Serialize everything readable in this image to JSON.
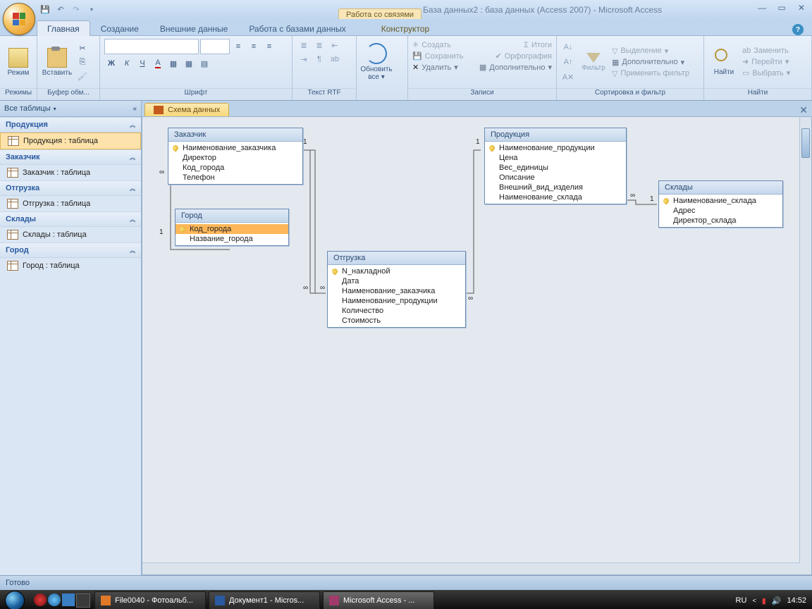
{
  "title": {
    "context": "Работа со связями",
    "main": "База данных2 : база данных (Access 2007) - Microsoft Access"
  },
  "ribbon": {
    "tabs": [
      "Главная",
      "Создание",
      "Внешние данные",
      "Работа с базами данных"
    ],
    "context_tab": "Конструктор",
    "active_index": 0,
    "groups": {
      "modes": "Режимы",
      "clipboard": "Буфер обм...",
      "font": "Шрифт",
      "rtf": "Текст RTF",
      "records": "Записи",
      "sortfilter": "Сортировка и фильтр",
      "find": "Найти"
    },
    "buttons": {
      "mode": "Режим",
      "paste": "Вставить",
      "refresh_l1": "Обновить",
      "refresh_l2": "все",
      "filter": "Фильтр",
      "find": "Найти",
      "bold": "Ж",
      "italic": "К",
      "underline": "Ч",
      "new": "Создать",
      "totals": "Итоги",
      "save": "Сохранить",
      "spelling": "Орфография",
      "delete": "Удалить",
      "more": "Дополнительно",
      "selection": "Выделение",
      "advanced": "Дополнительно",
      "toggle": "Применить фильтр",
      "replace": "Заменить",
      "goto": "Перейти",
      "select": "Выбрать"
    }
  },
  "navpane": {
    "header": "Все таблицы",
    "groups": [
      {
        "title": "Продукция",
        "items": [
          "Продукция : таблица"
        ],
        "active": true
      },
      {
        "title": "Заказчик",
        "items": [
          "Заказчик : таблица"
        ]
      },
      {
        "title": "Отгрузка",
        "items": [
          "Отгрузка : таблица"
        ]
      },
      {
        "title": "Склады",
        "items": [
          "Склады : таблица"
        ]
      },
      {
        "title": "Город",
        "items": [
          "Город : таблица"
        ]
      }
    ]
  },
  "doc_tab": "Схема данных",
  "entities": {
    "zakazchik": {
      "title": "Заказчик",
      "fields": [
        "Наименование_заказчика",
        "Директор",
        "Код_города",
        "Телефон"
      ],
      "key": 0
    },
    "gorod": {
      "title": "Город",
      "fields": [
        "Код_города",
        "Название_города"
      ],
      "key": 0,
      "selected": 0
    },
    "otgruzka": {
      "title": "Отгрузка",
      "fields": [
        "N_накладной",
        "Дата",
        "Наименование_заказчика",
        "Наименование_продукции",
        "Количество",
        "Стоимость"
      ],
      "key": 0
    },
    "produkciya": {
      "title": "Продукция",
      "fields": [
        "Наименование_продукции",
        "Цена",
        "Вес_единицы",
        "Описание",
        "Внешний_вид_изделия",
        "Наименование_склада"
      ],
      "key": 0
    },
    "sklady": {
      "title": "Склады",
      "fields": [
        "Наименование_склада",
        "Адрес",
        "Директор_склада"
      ],
      "key": 0
    }
  },
  "statusbar": "Готово",
  "taskbar": {
    "items": [
      "File0040 - Фотоальб...",
      "Документ1 - Micros...",
      "Microsoft Access - ..."
    ],
    "active_index": 2,
    "lang": "RU",
    "time": "14:52"
  }
}
